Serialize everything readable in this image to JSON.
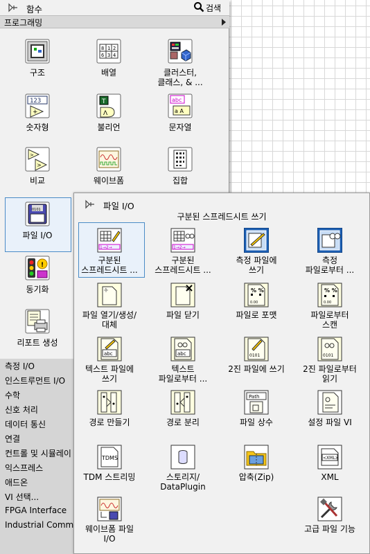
{
  "palette": {
    "title": "함수",
    "search_label": "검색",
    "category": "프로그래밍",
    "items": [
      {
        "label": "구조",
        "icon": "structures-icon"
      },
      {
        "label": "배열",
        "icon": "array-icon"
      },
      {
        "label": "클러스터,\n클래스, & ...",
        "icon": "cluster-class-icon"
      },
      {
        "label": "숫자형",
        "icon": "numeric-icon"
      },
      {
        "label": "불리언",
        "icon": "boolean-icon"
      },
      {
        "label": "문자열",
        "icon": "string-icon"
      },
      {
        "label": "비교",
        "icon": "comparison-icon"
      },
      {
        "label": "웨이브폼",
        "icon": "waveform-icon"
      },
      {
        "label": "집합",
        "icon": "set-icon"
      },
      {
        "label": "파일 I/O",
        "icon": "file-io-icon"
      },
      {
        "label": "동기화",
        "icon": "synchronization-icon"
      },
      {
        "label": "리포트 생성",
        "icon": "report-generation-icon"
      }
    ],
    "categories": [
      "측정 I/O",
      "인스트루먼트 I/O",
      "수학",
      "신호 처리",
      "데이터 통신",
      "연결",
      "컨트롤 및 시뮬레이",
      "익스프레스",
      "애드온",
      "VI 선택...",
      "FPGA Interface",
      "Industrial Commun"
    ]
  },
  "subpalette": {
    "title": "파일 I/O",
    "hover_label": "구분된 스프레드시트 쓰기",
    "items": [
      {
        "label": "구분된\n스프레드시트 ...",
        "icon": "write-delimited-spreadsheet-icon"
      },
      {
        "label": "구분된\n스프레드시트 ...",
        "icon": "read-delimited-spreadsheet-icon"
      },
      {
        "label": "측정 파일에\n쓰기",
        "icon": "write-measurement-file-icon"
      },
      {
        "label": "측정\n파일로부터 ...",
        "icon": "read-measurement-file-icon"
      },
      {
        "label": "파일 열기/생성/\n대체",
        "icon": "open-create-replace-file-icon"
      },
      {
        "label": "파일 닫기",
        "icon": "close-file-icon"
      },
      {
        "label": "파일로 포맷",
        "icon": "format-into-file-icon"
      },
      {
        "label": "파일로부터\n스캔",
        "icon": "scan-from-file-icon"
      },
      {
        "label": "텍스트 파일에\n쓰기",
        "icon": "write-text-file-icon"
      },
      {
        "label": "텍스트\n파일로부터 ...",
        "icon": "read-text-file-icon"
      },
      {
        "label": "2진 파일에 쓰기",
        "icon": "write-binary-file-icon"
      },
      {
        "label": "2진 파일로부터\n읽기",
        "icon": "read-binary-file-icon"
      },
      {
        "label": "경로 만들기",
        "icon": "build-path-icon"
      },
      {
        "label": "경로 분리",
        "icon": "strip-path-icon"
      },
      {
        "label": "파일 상수",
        "icon": "file-constants-icon"
      },
      {
        "label": "설정 파일 VI",
        "icon": "config-file-vis-icon"
      },
      {
        "label": "TDM 스트리밍",
        "icon": "tdm-streaming-icon"
      },
      {
        "label": "스토리지/\nDataPlugin",
        "icon": "storage-dataplugin-icon"
      },
      {
        "label": "압축(Zip)",
        "icon": "zip-icon"
      },
      {
        "label": "XML",
        "icon": "xml-icon"
      },
      {
        "label": "웨이브폼 파일\nI/O",
        "icon": "waveform-file-io-icon"
      },
      {
        "label": "고급 파일 기능",
        "icon": "advanced-file-functions-icon"
      }
    ]
  }
}
